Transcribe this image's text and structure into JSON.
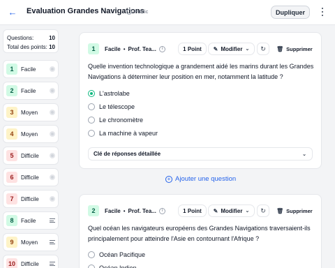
{
  "header": {
    "title": "Evaluation Grandes Navigations",
    "visibility": "Public",
    "duplicate_label": "Dupliquer"
  },
  "summary": {
    "questions_label": "Questions:",
    "questions_value": "10",
    "points_label": "Total des points:",
    "points_value": "10"
  },
  "sidebar": {
    "items": [
      {
        "num": "1",
        "label": "Facile",
        "color": "green",
        "icon": "radio-icon"
      },
      {
        "num": "2",
        "label": "Facile",
        "color": "green",
        "icon": "radio-icon"
      },
      {
        "num": "3",
        "label": "Moyen",
        "color": "yellow",
        "icon": "radio-icon"
      },
      {
        "num": "4",
        "label": "Moyen",
        "color": "yellow",
        "icon": "radio-icon"
      },
      {
        "num": "5",
        "label": "Difficile",
        "color": "red",
        "icon": "radio-icon"
      },
      {
        "num": "6",
        "label": "Difficile",
        "color": "red",
        "icon": "radio-icon"
      },
      {
        "num": "7",
        "label": "Difficile",
        "color": "red",
        "icon": "radio-icon"
      },
      {
        "num": "8",
        "label": "Facile",
        "color": "green",
        "icon": "text-lines-icon"
      },
      {
        "num": "9",
        "label": "Moyen",
        "color": "yellow",
        "icon": "text-lines-icon"
      },
      {
        "num": "10",
        "label": "Difficile",
        "color": "red",
        "icon": "text-lines-icon"
      }
    ]
  },
  "questions": [
    {
      "num": "1",
      "difficulty": "Facile",
      "author": "Prof. Tea...",
      "points": "1 Point",
      "modify": "Modifier",
      "delete": "Supprimer",
      "text": "Quelle invention technologique a grandement aidé les marins durant les Grandes Navigations à déterminer leur position en mer, notamment la latitude ?",
      "options": [
        "L'astrolabe",
        "Le télescope",
        "Le chronomètre",
        "La machine à vapeur"
      ],
      "selected": 0,
      "answer_key": "Clé de réponses détaillée"
    },
    {
      "num": "2",
      "difficulty": "Facile",
      "author": "Prof. Tea...",
      "points": "1 Point",
      "modify": "Modifier",
      "delete": "Supprimer",
      "text": "Quel océan les navigateurs européens des Grandes Navigations traversaient-ils principalement pour atteindre l'Asie en contournant l'Afrique ?",
      "options": [
        "Océan Pacifique",
        "Océan Indien"
      ]
    }
  ],
  "add_question_label": "Ajouter une question",
  "colors": {
    "accent": "#2563eb",
    "easy": "#d1fae5",
    "medium": "#fef3c7",
    "hard": "#fee2e2",
    "selected": "#10b981"
  }
}
